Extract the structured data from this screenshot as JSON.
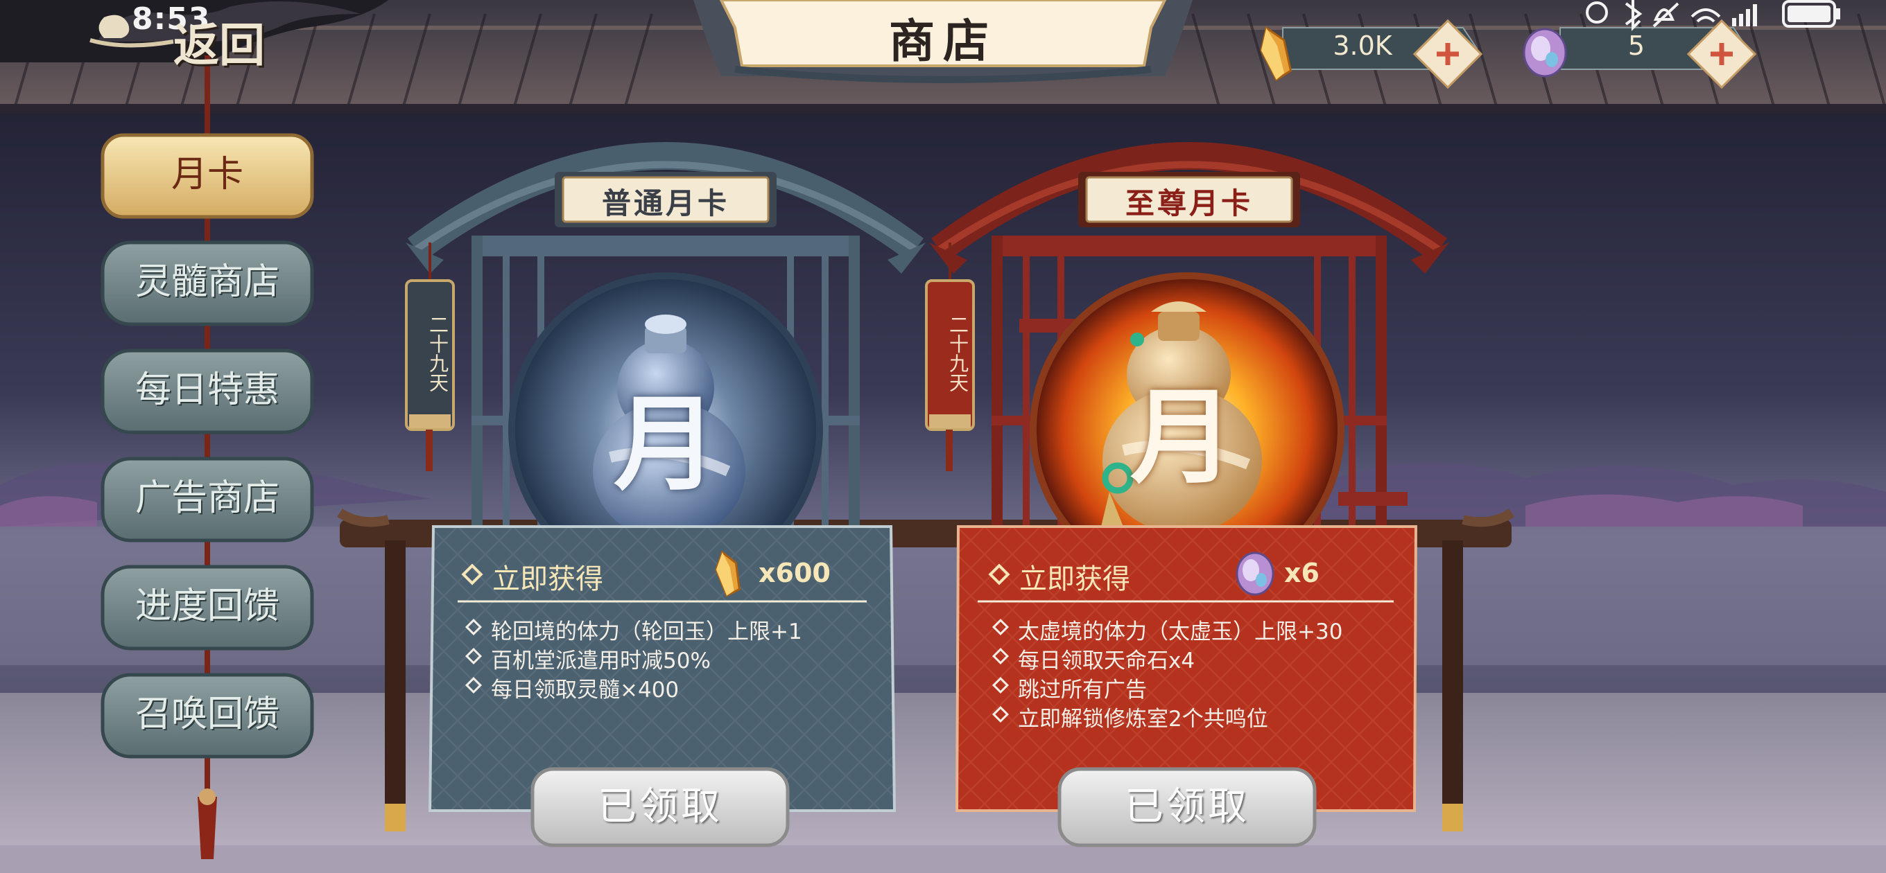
{
  "status_bar": {
    "time": "8:53"
  },
  "header": {
    "back_label": "返回",
    "title": "商店",
    "currencies": [
      {
        "icon": "gold-crystal-icon",
        "value": "3.0K"
      },
      {
        "icon": "purple-gem-icon",
        "value": "5"
      }
    ]
  },
  "sidebar": {
    "items": [
      {
        "label": "月卡",
        "active": true
      },
      {
        "label": "灵髓商店",
        "active": false
      },
      {
        "label": "每日特惠",
        "active": false
      },
      {
        "label": "广告商店",
        "active": false
      },
      {
        "label": "进度回馈",
        "active": false
      },
      {
        "label": "召唤回馈",
        "active": false
      }
    ]
  },
  "cards": [
    {
      "sign": "普通月卡",
      "days_left": "二十九天",
      "emblem_char": "月",
      "get_now": "立即获得",
      "reward_icon": "gold-crystal-icon",
      "reward_amount": "x600",
      "benefits": [
        "轮回境的体力（轮回玉）上限+1",
        "百机堂派遣用时减50%",
        "每日领取灵髓×400"
      ],
      "claim_label": "已领取",
      "colors": {
        "frame": "#53687a",
        "panel": "#4c6170"
      }
    },
    {
      "sign": "至尊月卡",
      "days_left": "二十九天",
      "emblem_char": "月",
      "get_now": "立即获得",
      "reward_icon": "purple-gem-icon",
      "reward_amount": "x6",
      "benefits": [
        "太虚境的体力（太虚玉）上限+30",
        "每日领取天命石x4",
        "跳过所有广告",
        "立即解锁修炼室2个共鸣位"
      ],
      "claim_label": "已领取",
      "colors": {
        "frame": "#8e2a22",
        "panel": "#b5321f"
      }
    }
  ]
}
